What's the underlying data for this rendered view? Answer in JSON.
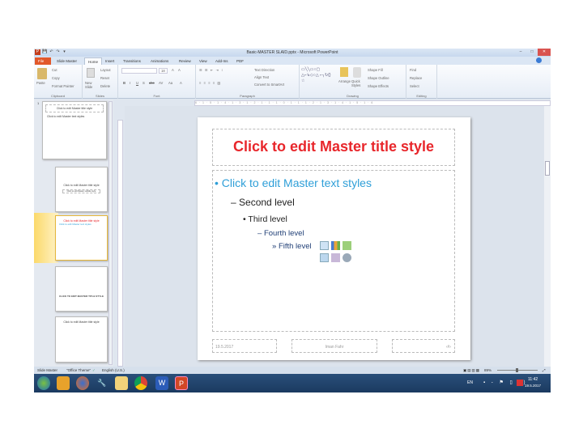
{
  "window": {
    "title": "Basic-MASTER SLAID.pptx - Microsoft PowerPoint",
    "app_icon": "P"
  },
  "quick_access": {
    "save": "💾",
    "undo": "↶",
    "redo": "↷",
    "more": "▾"
  },
  "window_controls": {
    "minimize": "–",
    "maximize": "□",
    "close": "✕"
  },
  "tabs": [
    "File",
    "Slide Master",
    "Home",
    "Insert",
    "Transitions",
    "Animations",
    "Review",
    "View",
    "Add-Ins",
    "PDF"
  ],
  "ribbon": {
    "clipboard": {
      "label": "Clipboard",
      "paste": "Paste",
      "cut": "Cut",
      "copy": "Copy",
      "format_painter": "Format Painter"
    },
    "slides": {
      "label": "Slides",
      "new_slide": "New Slide",
      "layout": "Layout",
      "reset": "Reset",
      "delete": "Delete"
    },
    "font": {
      "label": "Font",
      "size": "18",
      "bold": "B",
      "italic": "I",
      "underline": "U",
      "shadow": "S",
      "strike": "abc",
      "spacing": "AV",
      "case": "Aa",
      "color": "A",
      "grow": "A",
      "shrink": "A"
    },
    "paragraph": {
      "label": "Paragraph",
      "text_direction": "Text Direction",
      "align_text": "Align Text",
      "smartart": "Convert to SmartArt"
    },
    "drawing": {
      "label": "Drawing",
      "arrange": "Arrange",
      "quick_styles": "Quick Styles",
      "shape_fill": "Shape Fill",
      "shape_outline": "Shape Outline",
      "shape_effects": "Shape Effects"
    },
    "editing": {
      "label": "Editing",
      "find": "Find",
      "replace": "Replace",
      "select": "Select"
    }
  },
  "ruler": "6 · 1 · 5 · 1 · 4 · 1 · 3 · 1 · 2 · 1 · 1 · 1 · 0 · 1 · 1 · 1 · 2 · 1 · 3 · 1 · 4 · 1 · 5 · 1 · 6",
  "thumbnails": [
    {
      "num": "1",
      "title": "Click to edit Master title style",
      "body": "Click to edit Master text styles"
    },
    {
      "title": "Click to edit Master title style",
      "body": "Click to edit Master subtitle style"
    },
    {
      "title": "Click to edit Master title style",
      "body": "Click to edit Master text styles"
    },
    {
      "title": "CLICK TO EDIT MASTER TITLE STYLE"
    },
    {
      "title": "Click to edit Master title style"
    }
  ],
  "slide": {
    "title": "Click to edit Master title style",
    "levels": [
      "Click to edit Master text styles",
      "Second level",
      "Third level",
      "Fourth level",
      "Fifth level"
    ],
    "bullets": [
      "•",
      "–",
      "•",
      "–",
      "»"
    ],
    "footer": {
      "date": "19.5.2017",
      "center": "Iman Fahr",
      "page": "‹#›"
    },
    "title_color": "#e8262b",
    "level1_color": "#2f9fd8"
  },
  "status": {
    "view": "Slide Master",
    "theme": "\"Office Theme\"",
    "language": "English (U.S.)",
    "zoom": "89%"
  },
  "taskbar": {
    "lang": "EN",
    "time": "11:42",
    "date": "19.5.2017",
    "apps": [
      "start",
      "explorer",
      "firefox",
      "tool",
      "files",
      "chrome",
      "word",
      "powerpoint"
    ]
  }
}
